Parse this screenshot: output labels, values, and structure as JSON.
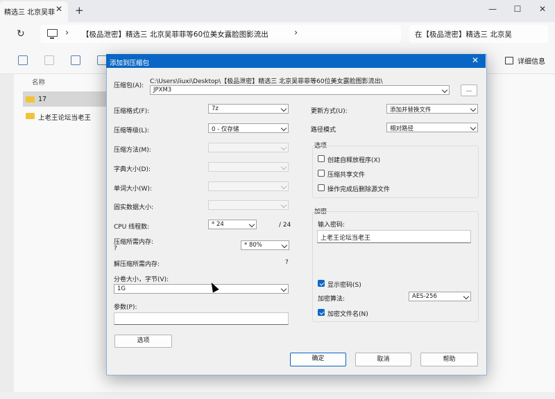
{
  "explorer": {
    "tab_title": "精选三 北京吴菲",
    "breadcrumb": "【极品泄密】精选三 北京吴菲菲等60位美女露脸图影流出",
    "search_text": "在【极品泄密】精选三 北京吴",
    "details_label": "详细信息",
    "column_name": "名称",
    "files": [
      {
        "name": "17",
        "selected": true
      },
      {
        "name": "上老王论坛当老王",
        "selected": false
      }
    ]
  },
  "dialog": {
    "title": "添加到压缩包",
    "archive_label": "压缩包(A):",
    "archive_path": "C:\\Users\\liuxi\\Desktop\\【极品泄密】精选三 北京吴菲菲等60位美女露脸图影流出\\",
    "archive_name": "JPXM3",
    "browse_label": "...",
    "format_label": "压缩格式(F):",
    "format_value": "7z",
    "level_label": "压缩等级(L):",
    "level_value": "0 - 仅存储",
    "method_label": "压缩方法(M):",
    "dict_label": "字典大小(D):",
    "word_label": "单词大小(W):",
    "solid_label": "固实数据大小:",
    "cpu_label": "CPU 线程数:",
    "cpu_value": "* 24",
    "cpu_total": "/ 24",
    "mem_label": "压缩所需内存:",
    "mem_q": "?",
    "mem_value": "* 80%",
    "decomp_label": "解压缩所需内存:",
    "decomp_q": "?",
    "split_label": "分卷大小，字节(V):",
    "split_value": "1G",
    "params_label": "参数(P):",
    "params_value": "",
    "options_button": "选项",
    "update_label": "更新方式(U):",
    "update_value": "添加并替换文件",
    "pathmode_label": "路径模式",
    "pathmode_value": "相对路径",
    "options_group": "选项",
    "opt_sfx": "创建自释放程序(X)",
    "opt_shared": "压缩共享文件",
    "opt_delete": "操作完成后删除源文件",
    "encrypt_group": "加密",
    "password_label": "输入密码:",
    "password_value": "上老王论坛当老王",
    "show_password": "显示密码(S)",
    "enc_method_label": "加密算法:",
    "enc_method_value": "AES-256",
    "encrypt_names": "加密文件名(N)",
    "ok": "确定",
    "cancel": "取消",
    "help": "帮助"
  }
}
